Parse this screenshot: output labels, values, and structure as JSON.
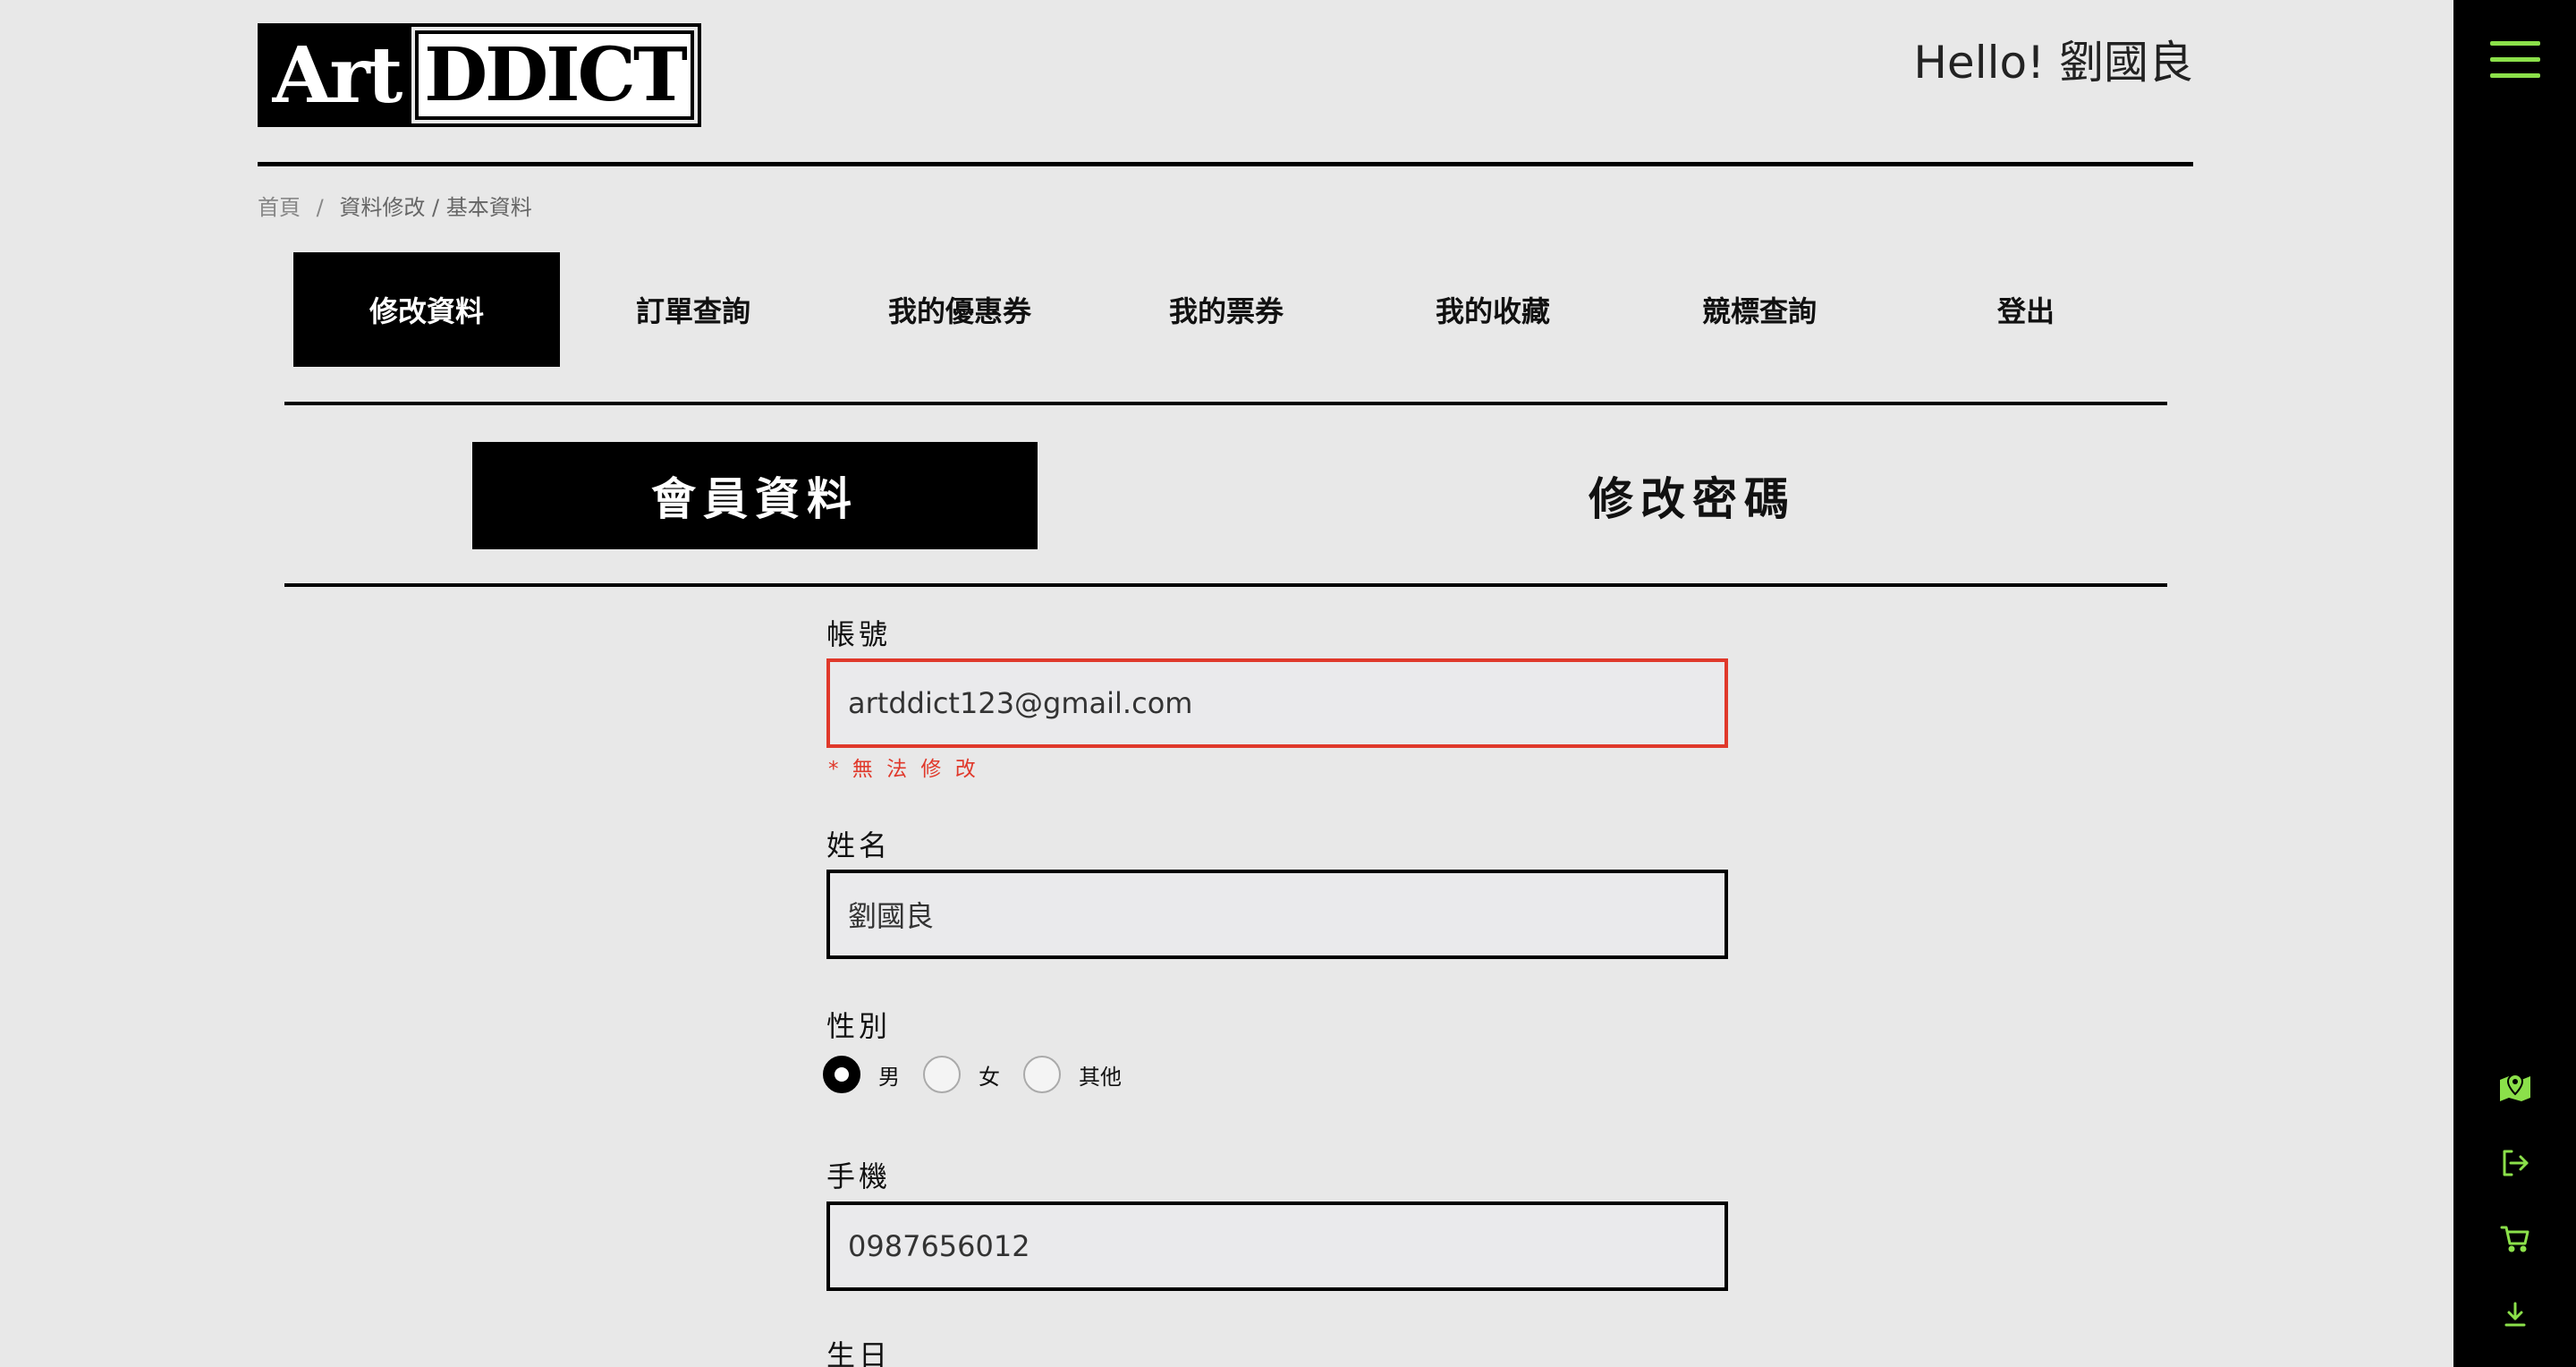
{
  "header": {
    "logo_left": "Art",
    "logo_right": "DDICT",
    "greeting": "Hello! 劉國良"
  },
  "breadcrumb": {
    "home": "首頁",
    "separator": "/",
    "current": "資料修改 / 基本資料"
  },
  "tabs": [
    {
      "label": "修改資料"
    },
    {
      "label": "訂單查詢"
    },
    {
      "label": "我的優惠券"
    },
    {
      "label": "我的票券"
    },
    {
      "label": "我的收藏"
    },
    {
      "label": "競標查詢"
    },
    {
      "label": "登出"
    }
  ],
  "subtabs": {
    "member_info": "會員資料",
    "change_password": "修改密碼"
  },
  "form": {
    "account_label": "帳號",
    "account_value": "artddict123@gmail.com",
    "account_note": "* 無 法 修 改",
    "name_label": "姓名",
    "name_value": "劉國良",
    "gender_label": "性別",
    "gender_options": [
      "男",
      "女",
      "其他"
    ],
    "gender_selected": "男",
    "phone_label": "手機",
    "phone_value": "0987656012",
    "birthday_label": "生日"
  },
  "colors": {
    "accent": "#8be04a",
    "error": "#e0392b",
    "background": "#e8e8e8"
  },
  "sidebar_icons": [
    "menu-icon",
    "map-icon",
    "logout-icon",
    "cart-icon",
    "download-icon"
  ]
}
